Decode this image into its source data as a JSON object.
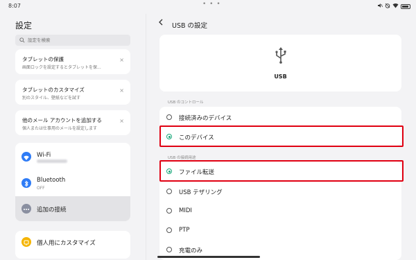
{
  "status_bar": {
    "time": "8:07",
    "center_indicator": "• • •",
    "icons": [
      "mute-icon",
      "alarm-icon",
      "wifi-icon",
      "battery-icon"
    ]
  },
  "sidebar": {
    "title": "設定",
    "search_placeholder": "設定を検索",
    "suggestions": [
      {
        "title": "タブレットの保護",
        "subtitle": "画面ロックを設定するとタブレットを保...",
        "dismiss": "×"
      },
      {
        "title": "タブレットのカスタマイズ",
        "subtitle": "別のスタイル、壁紙などを試す",
        "dismiss": "×"
      },
      {
        "title": "他のメール アカウントを追加する",
        "subtitle": "個人または仕事用のメールを設定します",
        "dismiss": "×"
      }
    ],
    "connections": {
      "wifi": {
        "label": "Wi-Fi",
        "icon": "wifi-icon"
      },
      "bluetooth": {
        "label": "Bluetooth",
        "status": "OFF",
        "icon": "bluetooth-icon"
      },
      "more": {
        "label": "追加の接続",
        "icon": "more-icon"
      }
    },
    "customize": {
      "label": "個人用にカスタマイズ",
      "icon": "palette-icon"
    }
  },
  "main": {
    "back_icon": "back-chevron-icon",
    "title": "USB の設定",
    "hero_label": "USB",
    "hero_icon": "usb-icon",
    "control_section": "USB のコントロール",
    "control_options": [
      {
        "label": "接続済みのデバイス",
        "selected": false
      },
      {
        "label": "このデバイス",
        "selected": true
      }
    ],
    "purpose_section": "USB の接続用途",
    "purpose_options": [
      {
        "label": "ファイル転送",
        "selected": true
      },
      {
        "label": "USB テザリング",
        "selected": false
      },
      {
        "label": "MIDI",
        "selected": false
      },
      {
        "label": "PTP",
        "selected": false
      },
      {
        "label": "充電のみ",
        "selected": false
      }
    ]
  },
  "colors": {
    "accent_radio": "#19a87a",
    "highlight_box": "#e00012",
    "wifi_icon_bg": "#2f7cf6",
    "bluetooth_icon_bg": "#2f7cf6",
    "more_icon_bg": "#8a8fa0",
    "customize_icon_bg": "#f5b400"
  }
}
